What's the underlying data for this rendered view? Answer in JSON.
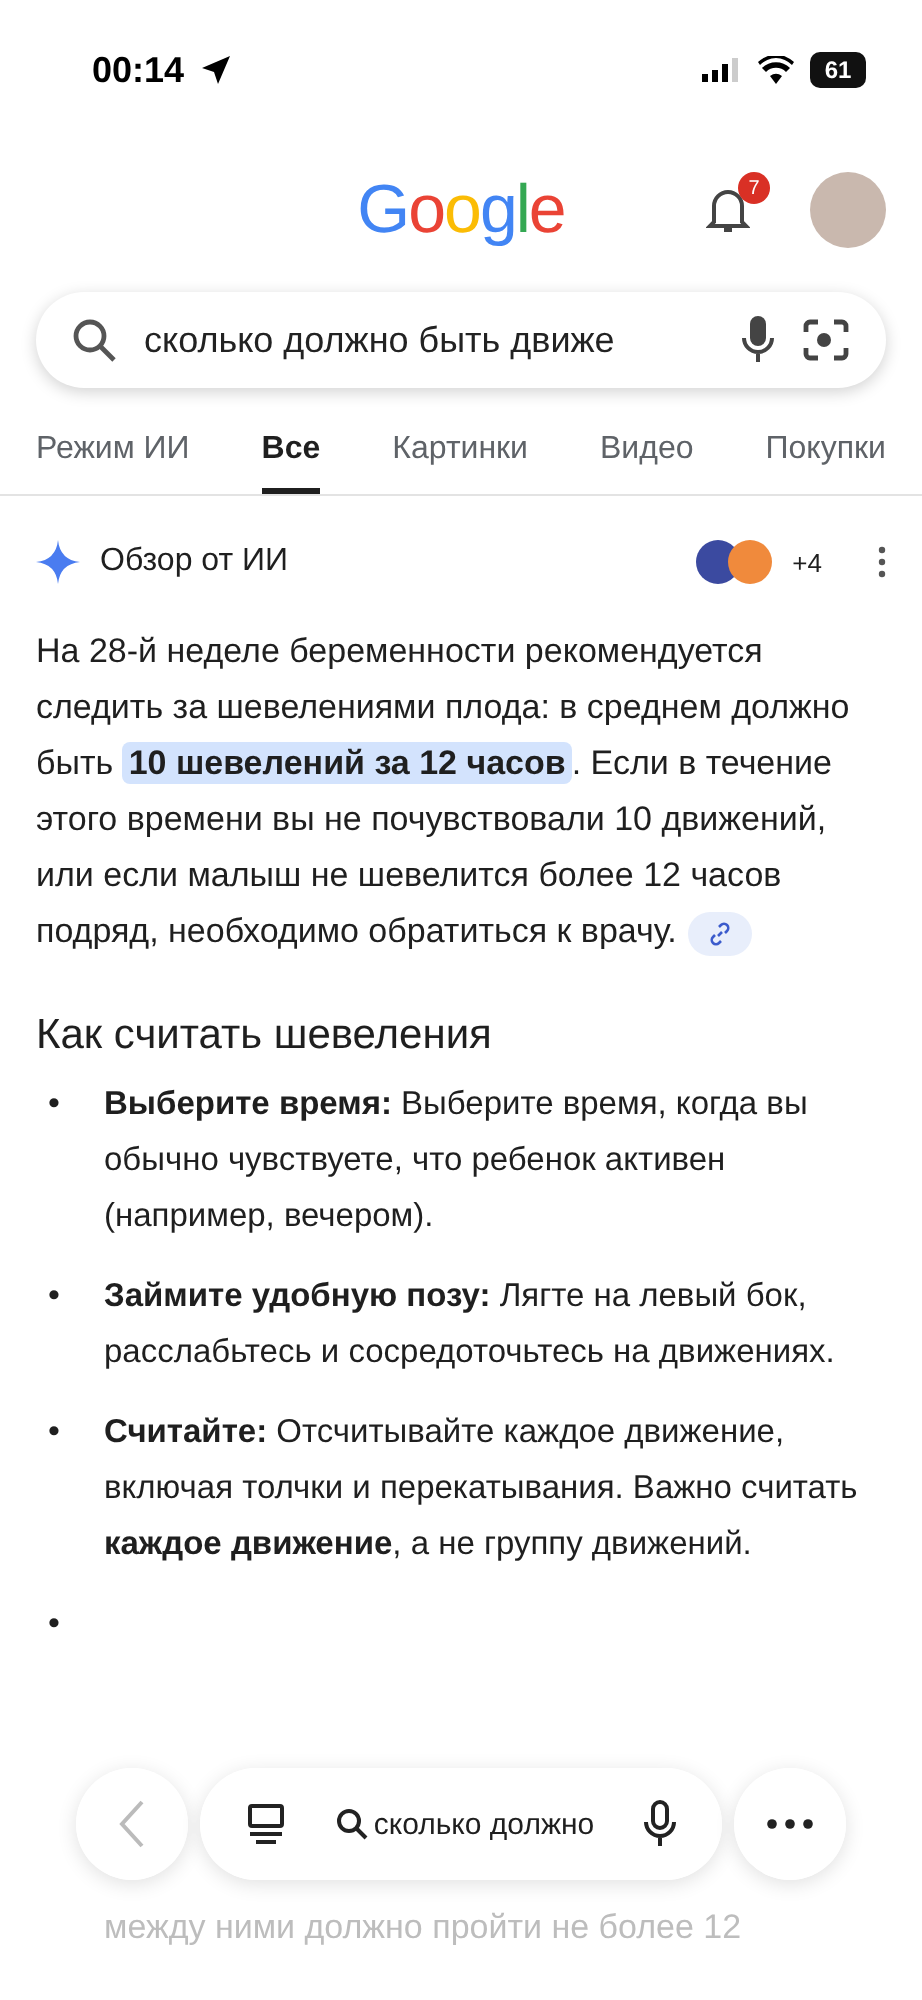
{
  "status_bar": {
    "time": "00:14",
    "battery": "61"
  },
  "header": {
    "logo": "Google",
    "notifications": "7"
  },
  "search": {
    "value": "сколько должно быть движе"
  },
  "tabs": [
    {
      "label": "Режим ИИ",
      "selected": false
    },
    {
      "label": "Все",
      "selected": true
    },
    {
      "label": "Картинки",
      "selected": false
    },
    {
      "label": "Видео",
      "selected": false
    },
    {
      "label": "Покупки",
      "selected": false
    }
  ],
  "ai_overview": {
    "title": "Обзор от ИИ",
    "sources_more": "+4",
    "paragraph_before": "На 28-й неделе беременности рекомендуется следить за шевелениями плода: в среднем должно быть ",
    "paragraph_highlight": "10 шевелений за 12 часов",
    "paragraph_after": ". Если в течение этого времени вы не почувствовали 10 движений, или если малыш не шевелится более 12 часов подряд, необходимо обратиться к врачу."
  },
  "section": {
    "heading": "Как считать шевеления",
    "bullets": [
      {
        "marker": "•",
        "text": "**Выберите время:** Выберите время, когда вы обычно чувствуете, что ребенок активен (например, вечером)."
      },
      {
        "marker": "•",
        "text": "**Займите удобную позу:** Лягте на левый бок, расслабьтесь и сосредоточьтесь на движениях."
      },
      {
        "marker": "•",
        "text": "**Считайте:** Отсчитывайте каждое движение, включая толчки и перекатывания. Важно считать **каждое движение**, а не группу движений."
      },
      {
        "marker": "•"
      }
    ],
    "faded_line": "между ними должно пройти не более 12"
  },
  "bottom_bar": {
    "query": "сколько должно"
  }
}
